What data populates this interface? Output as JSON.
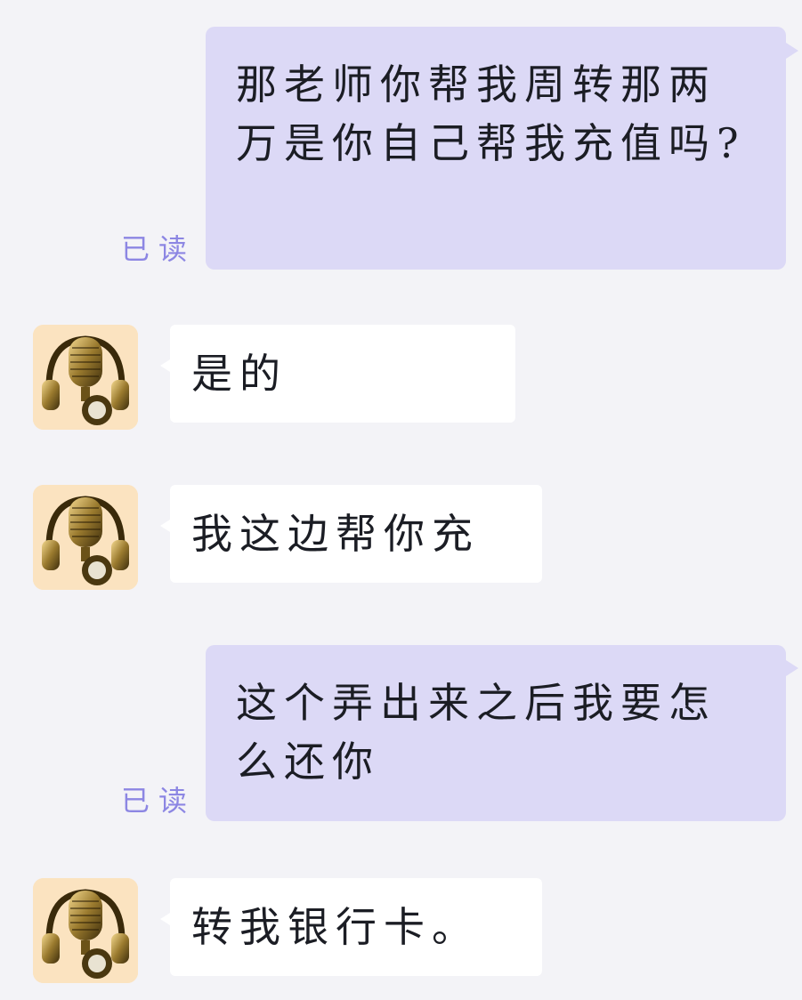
{
  "messages": [
    {
      "direction": "outgoing",
      "text": "那老师你帮我周转那两万是你自己帮我充值吗?",
      "status": "已读"
    },
    {
      "direction": "incoming",
      "text": "是的"
    },
    {
      "direction": "incoming",
      "text": "我这边帮你充"
    },
    {
      "direction": "outgoing",
      "text": "这个弄出来之后我要怎么还你",
      "status": "已读"
    },
    {
      "direction": "incoming",
      "text": "转我银行卡。"
    }
  ],
  "avatar": {
    "icon": "microphone-headphones-icon"
  },
  "colors": {
    "background": "#f3f3f7",
    "outgoing_bubble": "#dcd9f6",
    "incoming_bubble": "#ffffff",
    "read_status": "#8c86e3",
    "text": "#1b1d24"
  }
}
